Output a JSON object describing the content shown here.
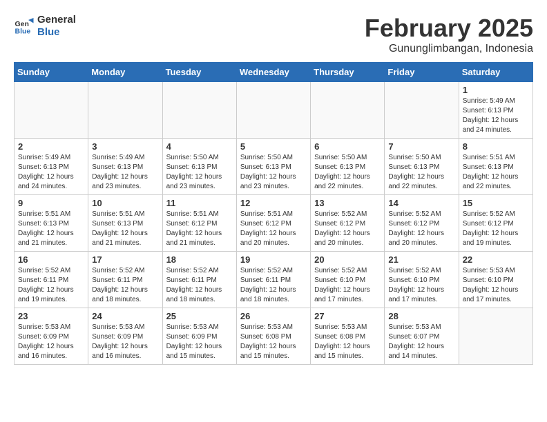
{
  "logo": {
    "line1": "General",
    "line2": "Blue"
  },
  "title": "February 2025",
  "subtitle": "Gununglimbangan, Indonesia",
  "days_of_week": [
    "Sunday",
    "Monday",
    "Tuesday",
    "Wednesday",
    "Thursday",
    "Friday",
    "Saturday"
  ],
  "weeks": [
    [
      {
        "day": "",
        "info": ""
      },
      {
        "day": "",
        "info": ""
      },
      {
        "day": "",
        "info": ""
      },
      {
        "day": "",
        "info": ""
      },
      {
        "day": "",
        "info": ""
      },
      {
        "day": "",
        "info": ""
      },
      {
        "day": "1",
        "info": "Sunrise: 5:49 AM\nSunset: 6:13 PM\nDaylight: 12 hours\nand 24 minutes."
      }
    ],
    [
      {
        "day": "2",
        "info": "Sunrise: 5:49 AM\nSunset: 6:13 PM\nDaylight: 12 hours\nand 24 minutes."
      },
      {
        "day": "3",
        "info": "Sunrise: 5:49 AM\nSunset: 6:13 PM\nDaylight: 12 hours\nand 23 minutes."
      },
      {
        "day": "4",
        "info": "Sunrise: 5:50 AM\nSunset: 6:13 PM\nDaylight: 12 hours\nand 23 minutes."
      },
      {
        "day": "5",
        "info": "Sunrise: 5:50 AM\nSunset: 6:13 PM\nDaylight: 12 hours\nand 23 minutes."
      },
      {
        "day": "6",
        "info": "Sunrise: 5:50 AM\nSunset: 6:13 PM\nDaylight: 12 hours\nand 22 minutes."
      },
      {
        "day": "7",
        "info": "Sunrise: 5:50 AM\nSunset: 6:13 PM\nDaylight: 12 hours\nand 22 minutes."
      },
      {
        "day": "8",
        "info": "Sunrise: 5:51 AM\nSunset: 6:13 PM\nDaylight: 12 hours\nand 22 minutes."
      }
    ],
    [
      {
        "day": "9",
        "info": "Sunrise: 5:51 AM\nSunset: 6:13 PM\nDaylight: 12 hours\nand 21 minutes."
      },
      {
        "day": "10",
        "info": "Sunrise: 5:51 AM\nSunset: 6:13 PM\nDaylight: 12 hours\nand 21 minutes."
      },
      {
        "day": "11",
        "info": "Sunrise: 5:51 AM\nSunset: 6:12 PM\nDaylight: 12 hours\nand 21 minutes."
      },
      {
        "day": "12",
        "info": "Sunrise: 5:51 AM\nSunset: 6:12 PM\nDaylight: 12 hours\nand 20 minutes."
      },
      {
        "day": "13",
        "info": "Sunrise: 5:52 AM\nSunset: 6:12 PM\nDaylight: 12 hours\nand 20 minutes."
      },
      {
        "day": "14",
        "info": "Sunrise: 5:52 AM\nSunset: 6:12 PM\nDaylight: 12 hours\nand 20 minutes."
      },
      {
        "day": "15",
        "info": "Sunrise: 5:52 AM\nSunset: 6:12 PM\nDaylight: 12 hours\nand 19 minutes."
      }
    ],
    [
      {
        "day": "16",
        "info": "Sunrise: 5:52 AM\nSunset: 6:11 PM\nDaylight: 12 hours\nand 19 minutes."
      },
      {
        "day": "17",
        "info": "Sunrise: 5:52 AM\nSunset: 6:11 PM\nDaylight: 12 hours\nand 18 minutes."
      },
      {
        "day": "18",
        "info": "Sunrise: 5:52 AM\nSunset: 6:11 PM\nDaylight: 12 hours\nand 18 minutes."
      },
      {
        "day": "19",
        "info": "Sunrise: 5:52 AM\nSunset: 6:11 PM\nDaylight: 12 hours\nand 18 minutes."
      },
      {
        "day": "20",
        "info": "Sunrise: 5:52 AM\nSunset: 6:10 PM\nDaylight: 12 hours\nand 17 minutes."
      },
      {
        "day": "21",
        "info": "Sunrise: 5:52 AM\nSunset: 6:10 PM\nDaylight: 12 hours\nand 17 minutes."
      },
      {
        "day": "22",
        "info": "Sunrise: 5:53 AM\nSunset: 6:10 PM\nDaylight: 12 hours\nand 17 minutes."
      }
    ],
    [
      {
        "day": "23",
        "info": "Sunrise: 5:53 AM\nSunset: 6:09 PM\nDaylight: 12 hours\nand 16 minutes."
      },
      {
        "day": "24",
        "info": "Sunrise: 5:53 AM\nSunset: 6:09 PM\nDaylight: 12 hours\nand 16 minutes."
      },
      {
        "day": "25",
        "info": "Sunrise: 5:53 AM\nSunset: 6:09 PM\nDaylight: 12 hours\nand 15 minutes."
      },
      {
        "day": "26",
        "info": "Sunrise: 5:53 AM\nSunset: 6:08 PM\nDaylight: 12 hours\nand 15 minutes."
      },
      {
        "day": "27",
        "info": "Sunrise: 5:53 AM\nSunset: 6:08 PM\nDaylight: 12 hours\nand 15 minutes."
      },
      {
        "day": "28",
        "info": "Sunrise: 5:53 AM\nSunset: 6:07 PM\nDaylight: 12 hours\nand 14 minutes."
      },
      {
        "day": "",
        "info": ""
      }
    ]
  ]
}
